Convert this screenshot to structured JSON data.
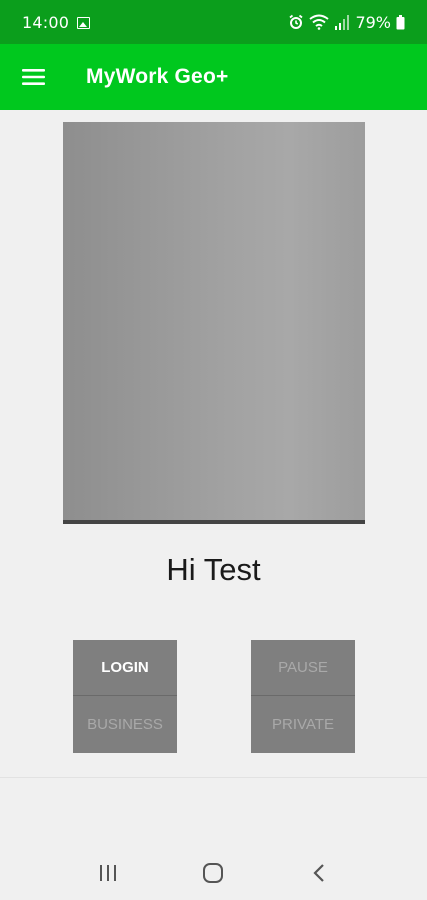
{
  "status_bar": {
    "time": "14:00",
    "battery": "79%",
    "icons": [
      "gallery-icon",
      "alarm-icon",
      "wifi-icon",
      "signal-icon",
      "battery-icon"
    ]
  },
  "app_bar": {
    "title": "MyWork Geo+",
    "menu_icon": "hamburger-menu-icon",
    "color": "#00c81e"
  },
  "main": {
    "greeting": "Hi Test",
    "left_group": {
      "top_label": "LOGIN",
      "bottom_label": "BUSINESS"
    },
    "right_group": {
      "top_label": "PAUSE",
      "bottom_label": "PRIVATE"
    }
  },
  "nav_bar": {
    "icons": [
      "recent-apps-icon",
      "home-icon",
      "back-icon"
    ]
  },
  "colors": {
    "status_bar": "#0b9e1c",
    "app_bar": "#00c81e",
    "button_bg": "#7f7f7f",
    "background": "#f0f0f0"
  }
}
